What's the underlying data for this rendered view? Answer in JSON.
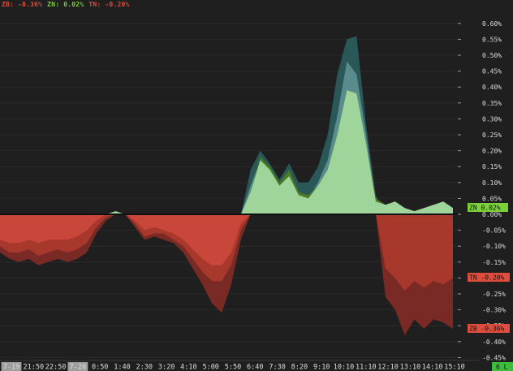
{
  "legend": {
    "zb": "ZB: -0.36%",
    "zn": "ZN: 0.02%",
    "tn": "TN: -0.20%"
  },
  "colors": {
    "background": "#1f1f1f",
    "zb": "#e04c3c",
    "zn": "#7bd13a",
    "tn": "#e04c3c",
    "zn_fill": "#9fd49b",
    "zb_fill_neg": "#7a2a24",
    "tn_fill_neg": "#b63d30",
    "teal": "#2f5d5e",
    "grid": "#2b2b2b"
  },
  "badges": {
    "zn": "ZN 0.02%",
    "tn": "TN -0.20%",
    "zb": "ZB -0.36%",
    "corner": "6 L"
  },
  "chart_data": {
    "type": "area",
    "ylim": [
      -0.45,
      0.62
    ],
    "y_ticks": [
      "0.60%",
      "0.55%",
      "0.50%",
      "0.45%",
      "0.40%",
      "0.35%",
      "0.30%",
      "0.25%",
      "0.20%",
      "0.15%",
      "0.10%",
      "0.05%",
      "0.00%",
      "-0.05%",
      "-0.10%",
      "-0.15%",
      "-0.20%",
      "-0.25%",
      "-0.30%",
      "-0.35%",
      "-0.40%",
      "-0.45%"
    ],
    "x_ticks": [
      "7-19",
      "21:50",
      "22:50",
      "7-20",
      "0:50",
      "1:40",
      "2:30",
      "3:20",
      "4:10",
      "5:00",
      "5:50",
      "6:40",
      "7:30",
      "8:20",
      "9:10",
      "10:10",
      "11:10",
      "12:10",
      "13:10",
      "14:10",
      "15:10"
    ],
    "highlighted_x_ticks": [
      "7-19",
      "7-20"
    ],
    "x_count": 48,
    "series": [
      {
        "name": "ZB",
        "values": [
          -0.12,
          -0.14,
          -0.15,
          -0.14,
          -0.16,
          -0.15,
          -0.14,
          -0.15,
          -0.14,
          -0.12,
          -0.06,
          -0.02,
          0.0,
          0.0,
          -0.04,
          -0.08,
          -0.07,
          -0.08,
          -0.09,
          -0.12,
          -0.17,
          -0.22,
          -0.28,
          -0.31,
          -0.22,
          -0.08,
          0.14,
          0.2,
          0.16,
          0.11,
          0.16,
          0.1,
          0.1,
          0.15,
          0.25,
          0.44,
          0.55,
          0.56,
          0.28,
          0.06,
          -0.26,
          -0.3,
          -0.38,
          -0.33,
          -0.36,
          -0.33,
          -0.34,
          -0.36
        ]
      },
      {
        "name": "ZN",
        "values": [
          -0.08,
          -0.09,
          -0.09,
          -0.08,
          -0.09,
          -0.08,
          -0.08,
          -0.08,
          -0.07,
          -0.05,
          -0.02,
          0.0,
          0.01,
          0.0,
          -0.02,
          -0.05,
          -0.04,
          -0.05,
          -0.06,
          -0.08,
          -0.11,
          -0.14,
          -0.16,
          -0.16,
          -0.12,
          -0.03,
          0.07,
          0.18,
          0.15,
          0.1,
          0.14,
          0.07,
          0.06,
          0.09,
          0.14,
          0.25,
          0.39,
          0.38,
          0.22,
          0.05,
          0.03,
          0.04,
          0.02,
          0.01,
          0.02,
          0.03,
          0.04,
          0.02
        ]
      },
      {
        "name": "TN",
        "values": [
          -0.1,
          -0.12,
          -0.12,
          -0.11,
          -0.13,
          -0.12,
          -0.11,
          -0.12,
          -0.11,
          -0.09,
          -0.04,
          -0.01,
          0.0,
          0.0,
          -0.03,
          -0.07,
          -0.06,
          -0.06,
          -0.08,
          -0.1,
          -0.14,
          -0.18,
          -0.21,
          -0.21,
          -0.16,
          -0.05,
          0.09,
          0.17,
          0.14,
          0.09,
          0.12,
          0.06,
          0.05,
          0.1,
          0.17,
          0.31,
          0.48,
          0.44,
          0.25,
          0.04,
          -0.17,
          -0.2,
          -0.24,
          -0.21,
          -0.23,
          -0.21,
          -0.22,
          -0.2
        ]
      }
    ]
  }
}
